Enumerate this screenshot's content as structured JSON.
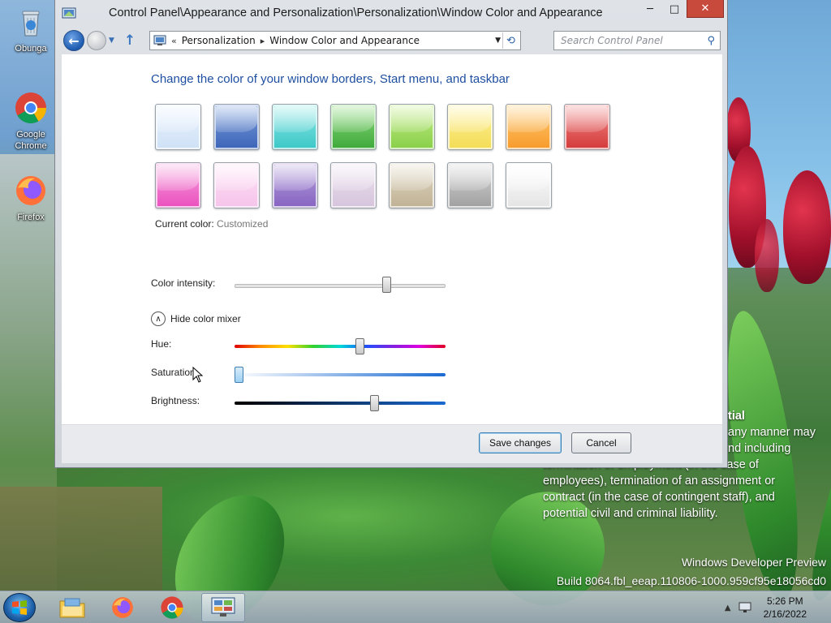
{
  "desktop": {
    "icons": [
      {
        "label": "Obunga",
        "icon": "recycle-bin-icon"
      },
      {
        "label": "Google Chrome",
        "icon": "chrome-icon"
      },
      {
        "label": "Firefox",
        "icon": "firefox-icon"
      }
    ],
    "background_text": [
      "tial",
      "any manner may",
      "nd including",
      "termination of employment (in the case of",
      "employees), termination of an assignment or",
      "contract (in the case of contingent staff), and",
      "potential civil and criminal liability."
    ],
    "watermark": {
      "line1": "Windows Developer Preview",
      "line2": "Build 8064.fbl_eeap.110806-1000.959cf95e18056cd0"
    }
  },
  "window": {
    "title": "Control Panel\\Appearance and Personalization\\Personalization\\Window Color and Appearance",
    "controls": {
      "minimize": "─",
      "maximize": "□",
      "close": "✕"
    },
    "address": {
      "prefix": "«",
      "crumbs": [
        "Personalization",
        "Window Color and Appearance"
      ],
      "separator": "▸"
    },
    "search_placeholder": "Search Control Panel",
    "heading": "Change the color of your window borders, Start menu, and taskbar",
    "swatches": [
      {
        "name": "sky",
        "colors": [
          "#eaf3fd",
          "#cfe1f6"
        ]
      },
      {
        "name": "twilight",
        "colors": [
          "#7c9fdc",
          "#3c64b8"
        ]
      },
      {
        "name": "sea-foam",
        "colors": [
          "#8ee8e6",
          "#3bc7c7"
        ]
      },
      {
        "name": "leaf",
        "colors": [
          "#8fdc7d",
          "#3da83a"
        ]
      },
      {
        "name": "lime",
        "colors": [
          "#c4ee8a",
          "#88cf48"
        ]
      },
      {
        "name": "lemon",
        "colors": [
          "#fff3a0",
          "#f3dc54"
        ]
      },
      {
        "name": "pumpkin",
        "colors": [
          "#ffce78",
          "#f79a2a"
        ]
      },
      {
        "name": "ruby",
        "colors": [
          "#f28a8a",
          "#d43a3a"
        ]
      },
      {
        "name": "fuchsia",
        "colors": [
          "#f7a4e0",
          "#ea4fbd"
        ]
      },
      {
        "name": "blush",
        "colors": [
          "#fde2f6",
          "#f6c3ea"
        ]
      },
      {
        "name": "violet",
        "colors": [
          "#b7a2dd",
          "#8663c1"
        ]
      },
      {
        "name": "lavender",
        "colors": [
          "#ece2ef",
          "#d6c4dc"
        ]
      },
      {
        "name": "taupe",
        "colors": [
          "#e2dac5",
          "#bfb194"
        ]
      },
      {
        "name": "chocolate",
        "colors": [
          "#d6d6d6",
          "#a0a0a0"
        ]
      },
      {
        "name": "frost",
        "colors": [
          "#ffffff",
          "#e4e4e4"
        ]
      }
    ],
    "current_color_label": "Current color:",
    "current_color_value": "Customized",
    "color_intensity_label": "Color intensity:",
    "color_intensity": 0.73,
    "mixer_toggle": "Hide color mixer",
    "hue_label": "Hue:",
    "hue": 0.6,
    "saturation_label": "Saturation:",
    "saturation": 0.0,
    "brightness_label": "Brightness:",
    "brightness": 0.67,
    "buttons": {
      "save": "Save changes",
      "cancel": "Cancel"
    }
  },
  "taskbar": {
    "items": [
      "file-explorer",
      "firefox",
      "chrome",
      "control-panel"
    ],
    "time": "5:26 PM",
    "date": "2/16/2022"
  }
}
